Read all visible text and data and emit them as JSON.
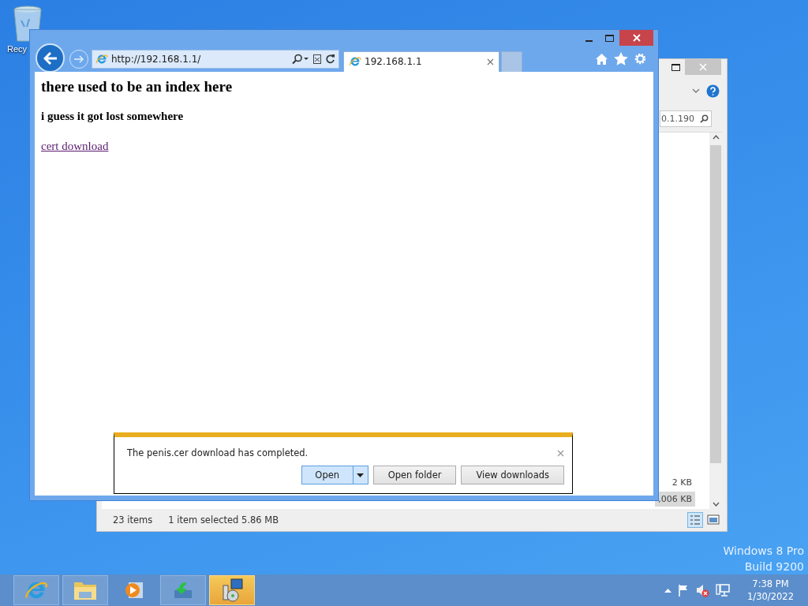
{
  "desktop": {
    "icons": [
      {
        "label": "Recy"
      }
    ],
    "edition": [
      "Windows 8 Pro",
      "Build 9200"
    ]
  },
  "explorer": {
    "search": "0.1.190",
    "sizes": [
      {
        "text": "2 KB",
        "selected": false
      },
      {
        "text": ",006 KB",
        "selected": true
      }
    ],
    "status": {
      "items": "23 items",
      "selection": "1 item selected",
      "size": "5.86 MB"
    }
  },
  "browser": {
    "address": "http://192.168.1.1/",
    "tabs": [
      {
        "title": "192.168.1.1",
        "selected": true
      }
    ],
    "page": {
      "heading": "there used to be an index here",
      "subheading": "i guess it got lost somewhere",
      "link": "cert download"
    },
    "download_bar": {
      "message": "The penis.cer download has completed.",
      "buttons": [
        {
          "label": "Open",
          "kind": "split",
          "selected": true
        },
        {
          "label": "Open folder",
          "kind": "plain",
          "selected": false
        },
        {
          "label": "View downloads",
          "kind": "plain",
          "selected": false
        }
      ]
    }
  },
  "taskbar": {
    "apps": [
      {
        "kind": "browser",
        "running": true,
        "selected": false
      },
      {
        "kind": "folder",
        "running": true,
        "selected": false
      },
      {
        "kind": "media",
        "running": false,
        "selected": false
      },
      {
        "kind": "download",
        "running": true,
        "selected": false
      },
      {
        "kind": "setup",
        "running": true,
        "selected": true
      }
    ],
    "clock": {
      "time": "7:38 PM",
      "date": "1/30/2022"
    }
  }
}
